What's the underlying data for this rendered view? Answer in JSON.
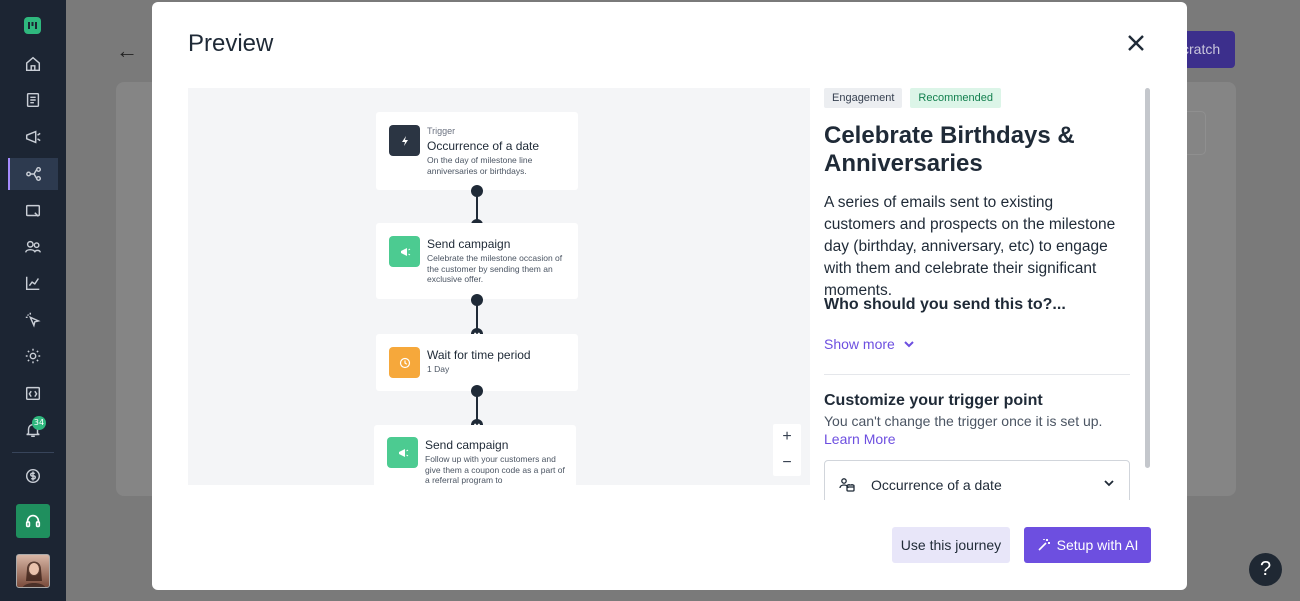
{
  "sidebar": {
    "notification_count": "34"
  },
  "background": {
    "scratch_button_label": "cratch"
  },
  "modal": {
    "title": "Preview",
    "flow": [
      {
        "label": "Trigger",
        "title": "Occurrence of a date",
        "desc": "On the day of milestone line anniversaries or birthdays.",
        "icon": "lightning-icon",
        "color": "#2b3543"
      },
      {
        "title": "Send campaign",
        "desc": "Celebrate the milestone occasion of the customer by sending them an exclusive offer.",
        "icon": "megaphone-icon",
        "color": "#4ccb91"
      },
      {
        "title": "Wait for time period",
        "desc": "1 Day",
        "icon": "clock-icon",
        "color": "#f6a83b"
      },
      {
        "title": "Send campaign",
        "desc": "Follow up with your customers and give them a coupon code as a part of a referral program to",
        "icon": "megaphone-icon",
        "color": "#4ccb91"
      }
    ],
    "zoom_in": "+",
    "zoom_out": "−",
    "panel": {
      "tags": [
        "Engagement",
        "Recommended"
      ],
      "title": "Celebrate Birthdays & Anniversaries",
      "description": "A series of emails sent to existing customers and prospects on the milestone day (birthday, anniversary, etc) to engage with them and celebrate their significant moments.",
      "question": "Who should you send this to?...",
      "show_more": "Show more",
      "customize_title": "Customize your trigger point",
      "customize_note": "You can't change the trigger once it is set up.",
      "learn_more": "Learn More",
      "trigger_value": "Occurrence of a date"
    },
    "buttons": {
      "use": "Use this journey",
      "ai": "Setup with AI"
    }
  }
}
